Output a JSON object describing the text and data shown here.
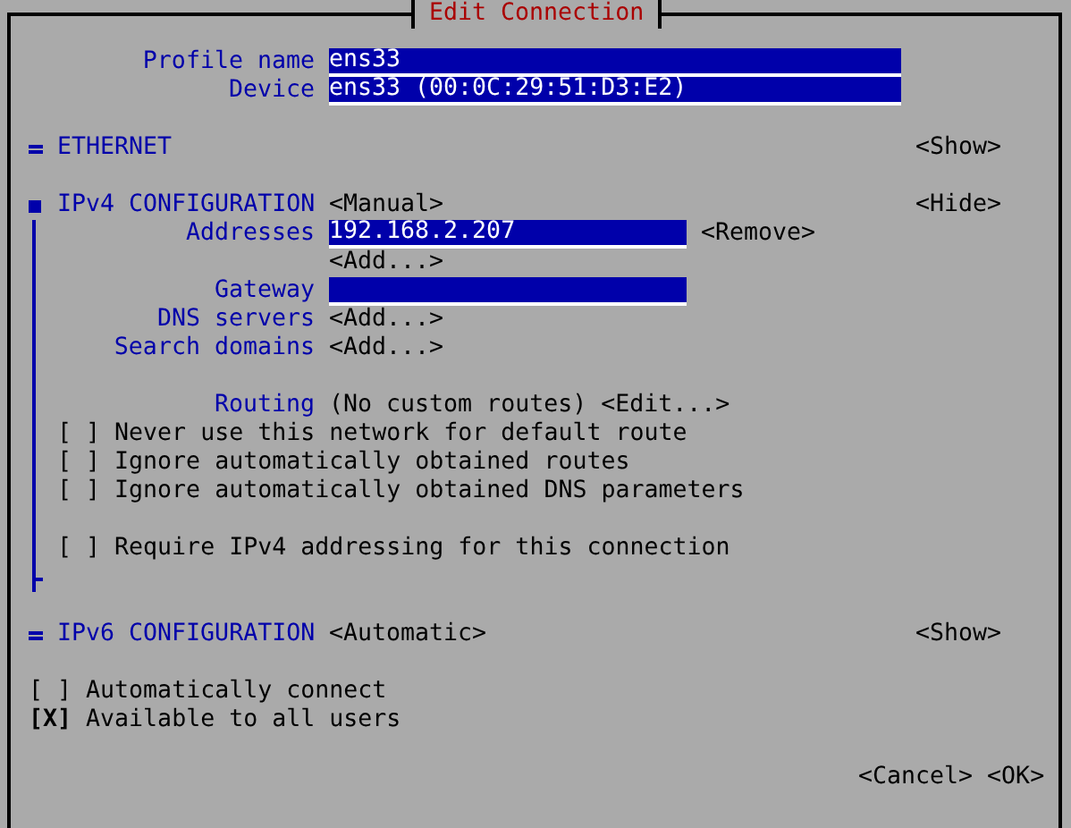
{
  "window": {
    "title": "Edit Connection"
  },
  "profile_fields": [
    {
      "label": "Profile name",
      "value": "ens33"
    },
    {
      "label": "Device",
      "value": "ens33 (00:0C:29:51:D3:E2)"
    }
  ],
  "ethernet": {
    "title": "ETHERNET",
    "toggle": "<Show>",
    "expanded": false
  },
  "ipv4": {
    "title": "IPv4 CONFIGURATION",
    "mode": "<Manual>",
    "toggle": "<Hide>",
    "expanded": true,
    "addresses": {
      "label": "Addresses",
      "items": [
        {
          "value": "192.168.2.207",
          "remove": "<Remove>"
        }
      ],
      "add": "<Add...>"
    },
    "gateway": {
      "label": "Gateway"
    },
    "dns_servers": {
      "label": "DNS servers",
      "add": "<Add...>"
    },
    "search_domains": {
      "label": "Search domains",
      "add": "<Add...>"
    },
    "routing": {
      "label": "Routing",
      "value": "(No custom routes)",
      "edit": "<Edit...>"
    },
    "options": [
      {
        "box": "[ ]",
        "label": "Never use this network for default route",
        "checked": false
      },
      {
        "box": "[ ]",
        "label": "Ignore automatically obtained routes",
        "checked": false
      },
      {
        "box": "[ ]",
        "label": "Ignore automatically obtained DNS parameters",
        "checked": false
      }
    ],
    "require_option": {
      "box": "[ ]",
      "label": "Require IPv4 addressing for this connection",
      "checked": false
    }
  },
  "ipv6": {
    "title": "IPv6 CONFIGURATION",
    "mode": "<Automatic>",
    "toggle": "<Show>",
    "expanded": false
  },
  "options": [
    {
      "box": "[ ]",
      "label": "Automatically connect",
      "checked": false
    },
    {
      "box": "[X]",
      "label": "Available to all users",
      "checked": true
    }
  ],
  "buttons": [
    "<Cancel>",
    "<OK>"
  ]
}
